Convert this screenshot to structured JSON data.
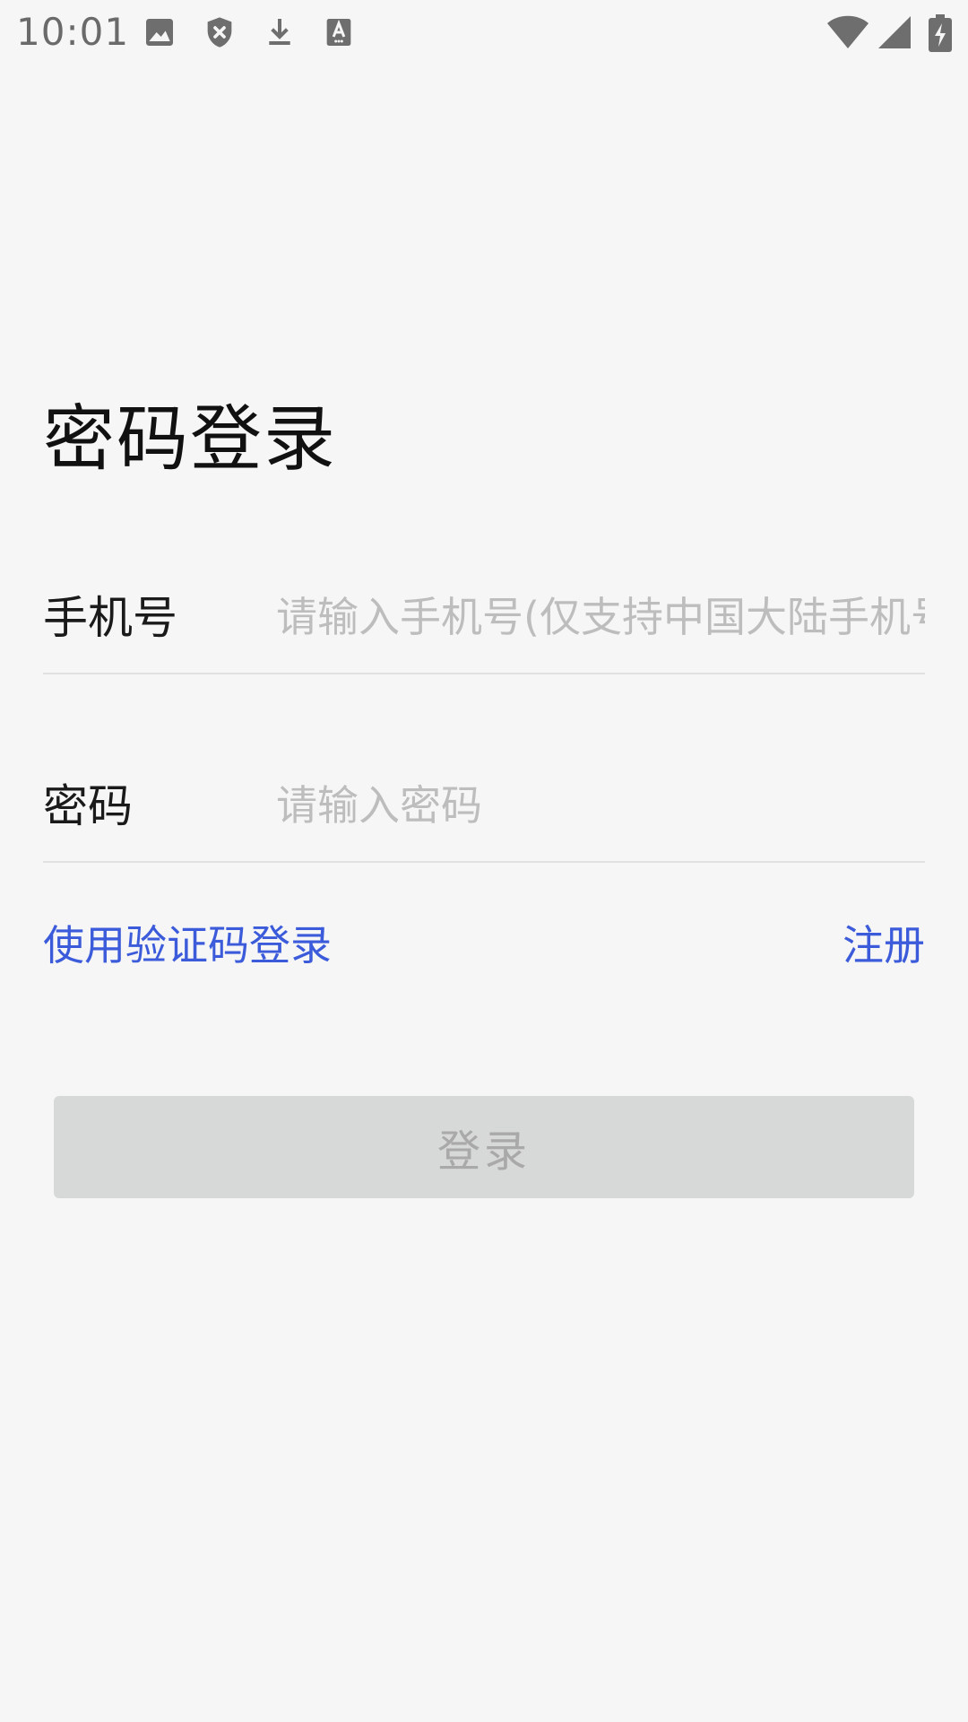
{
  "status_bar": {
    "time": "10:01",
    "icons": [
      "image-icon",
      "shield-x-icon",
      "download-icon",
      "keyboard-a-icon",
      "wifi-icon",
      "cellular-signal-icon",
      "battery-charging-icon"
    ]
  },
  "page": {
    "title": "密码登录"
  },
  "phone_field": {
    "label": "手机号",
    "placeholder": "请输入手机号(仅支持中国大陆手机号)",
    "value": ""
  },
  "password_field": {
    "label": "密码",
    "placeholder": "请输入密码",
    "value": ""
  },
  "links": {
    "sms_login": "使用验证码登录",
    "register": "注册"
  },
  "login_button": {
    "label": "登录",
    "enabled": false
  },
  "colors": {
    "background": "#f6f6f6",
    "link": "#3b5bdb",
    "button_disabled_bg": "#d7d8d8",
    "button_disabled_text": "#a9a9a9",
    "placeholder": "#bdbdbd"
  }
}
